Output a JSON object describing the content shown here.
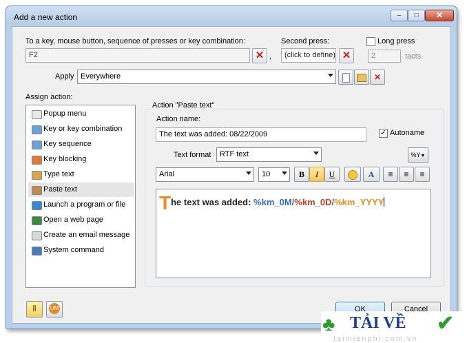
{
  "window": {
    "title": "Add a new action"
  },
  "hotkey": {
    "label": "To a key, mouse button, sequence of presses or key combination:",
    "value": "F2",
    "comma": ",",
    "second_label": "Second press:",
    "second_value": "(click to define)",
    "long_press_label": "Long press",
    "long_press_checked": false,
    "tacts_value": "2",
    "tacts_label": "tacts"
  },
  "apply": {
    "label": "Apply",
    "value": "Everywhere"
  },
  "assign": {
    "label": "Assign action:",
    "items": [
      {
        "label": "Popup menu",
        "icon": "popup-menu-icon",
        "color": "#e8e8e8"
      },
      {
        "label": "Key or key combination",
        "icon": "keyboard-icon",
        "color": "#6e9fd6"
      },
      {
        "label": "Key sequence",
        "icon": "key-sequence-icon",
        "color": "#6e9fd6"
      },
      {
        "label": "Key blocking",
        "icon": "key-blocking-icon",
        "color": "#e07a2c"
      },
      {
        "label": "Type text",
        "icon": "type-text-icon",
        "color": "#d9a64a"
      },
      {
        "label": "Paste text",
        "icon": "paste-text-icon",
        "color": "#c08a4a"
      },
      {
        "label": "Launch a program or file",
        "icon": "launch-program-icon",
        "color": "#3a86d0"
      },
      {
        "label": "Open a web page",
        "icon": "web-page-icon",
        "color": "#3d8a3d"
      },
      {
        "label": "Create an email message",
        "icon": "email-icon",
        "color": "#d8d8d8"
      },
      {
        "label": "System command",
        "icon": "system-command-icon",
        "color": "#4a7ab8"
      }
    ],
    "selected_index": 5
  },
  "action": {
    "group_title": "Action \"Paste text\"",
    "name_label": "Action name:",
    "name_value": "The text was added: 08/22/2009",
    "autoname_label": "Autoname",
    "autoname_checked": true,
    "format_label": "Text format",
    "format_value": "RTF text",
    "macro_button": "%Y",
    "font_value": "Arial",
    "size_value": "10",
    "bold": "B",
    "italic": "I",
    "underline": "U",
    "color_a": "A"
  },
  "editor": {
    "drop_cap": "T",
    "text_plain": "he text was added: ",
    "m": "%km_0M",
    "slash1": "/",
    "d": "%km_0D",
    "slash2": "/",
    "y": "%km_YYYY",
    "colors": {
      "drop_cap": "#f08a1c",
      "month": "#2f6fc8",
      "day": "#d23b2a",
      "year": "#f08a1c"
    }
  },
  "footer": {
    "ok": "OK",
    "cancel": "Cancel"
  },
  "watermark": {
    "text": "TẢI VỀ",
    "sub": "taimienphi.com.vn"
  }
}
